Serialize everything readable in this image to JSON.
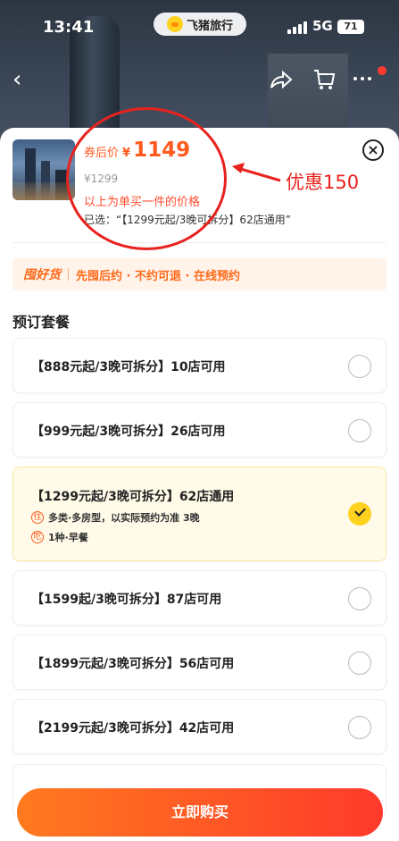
{
  "status_bar": {
    "time": "13:41",
    "app_name": "飞猪旅行",
    "network": "5G",
    "battery": "71"
  },
  "nav": {
    "back_icon": "chevron-left-icon",
    "share_icon": "share-icon",
    "cart_icon": "cart-icon",
    "more_icon": "more-icon"
  },
  "product": {
    "price_label": "券后价",
    "currency": "¥",
    "price": "1149",
    "original_price": "¥1299",
    "single_note": "以上为单买一件的价格",
    "selected_text": "已选：“【1299元起/3晚可拆分】62店通用”"
  },
  "annotation": {
    "text": "优惠150",
    "color": "#e8231f"
  },
  "promo": {
    "badge": "囤好货",
    "text": "先囤后约 · 不约可退 · 在线预约"
  },
  "section_title": "预订套餐",
  "packages": [
    {
      "label": "【888元起/3晚可拆分】10店可用",
      "selected": false
    },
    {
      "label": "【999元起/3晚可拆分】26店可用",
      "selected": false
    },
    {
      "label": "【1299元起/3晚可拆分】62店通用",
      "selected": true,
      "details": [
        {
          "tag": "住",
          "text": "多类·多房型，以实际预约为准 3晚"
        },
        {
          "tag": "吃",
          "text": "1种·早餐"
        }
      ]
    },
    {
      "label": "【1599起/3晚可拆分】87店可用",
      "selected": false
    },
    {
      "label": "【1899元起/3晚可拆分】56店可用",
      "selected": false
    },
    {
      "label": "【2199元起/3晚可拆分】42店可用",
      "selected": false
    }
  ],
  "buy_button": "立即购买",
  "colors": {
    "accent": "#ff5a1f",
    "check": "#ffd21f",
    "button_start": "#ff7a1f",
    "button_end": "#ff3a2b"
  }
}
